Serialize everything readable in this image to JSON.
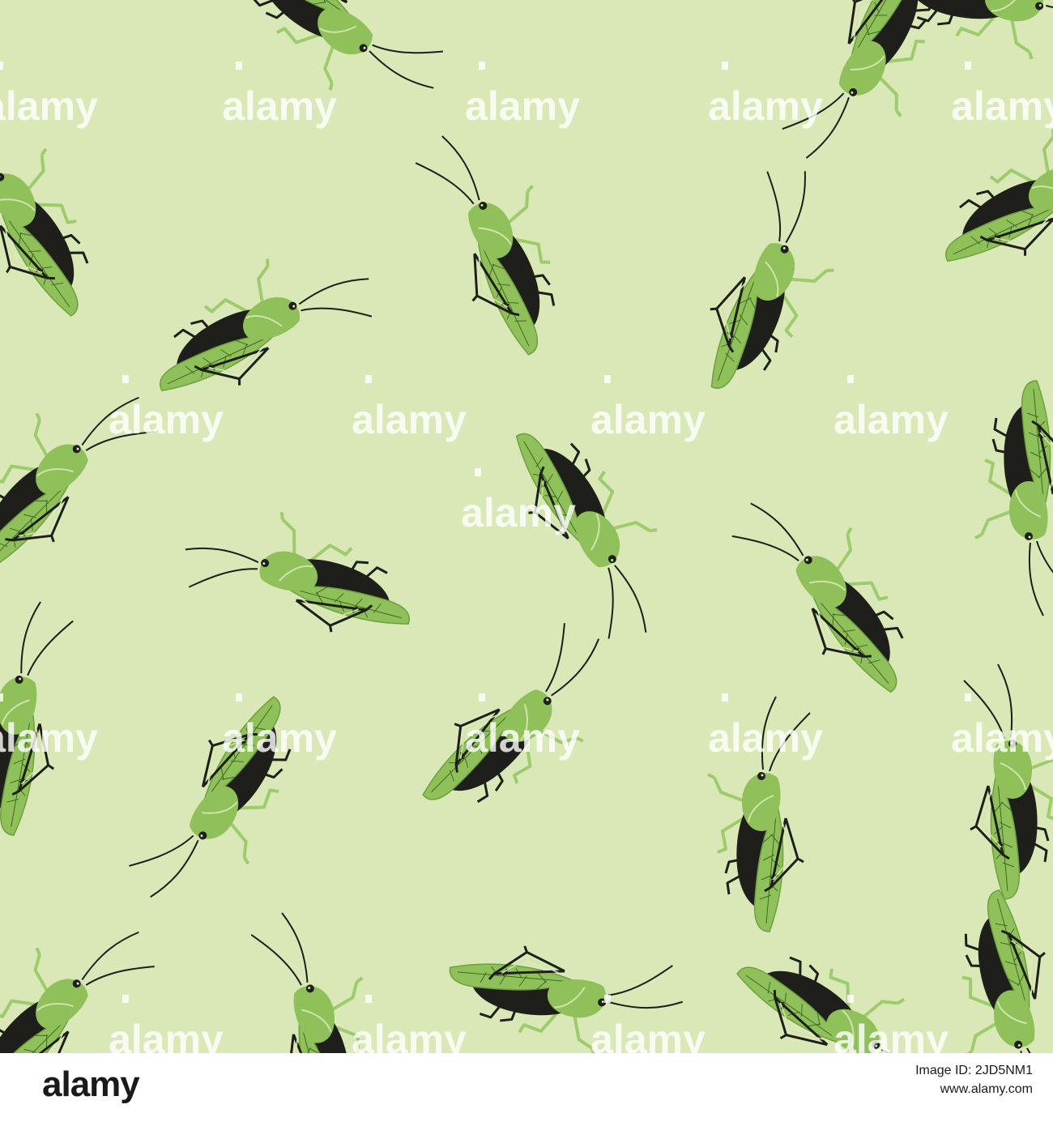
{
  "colors": {
    "background": "#d9e8b6",
    "body_light": "#8fc05a",
    "body_mid": "#6ea040",
    "dark": "#1e1f1a",
    "legs": "#9ccc6c",
    "watermark": "#ffffff"
  },
  "watermark": {
    "text": "alamy"
  },
  "footer": {
    "logo": "alamy",
    "image_id": "Image ID: 2JD5NM1",
    "site": "www.alamy.com"
  }
}
